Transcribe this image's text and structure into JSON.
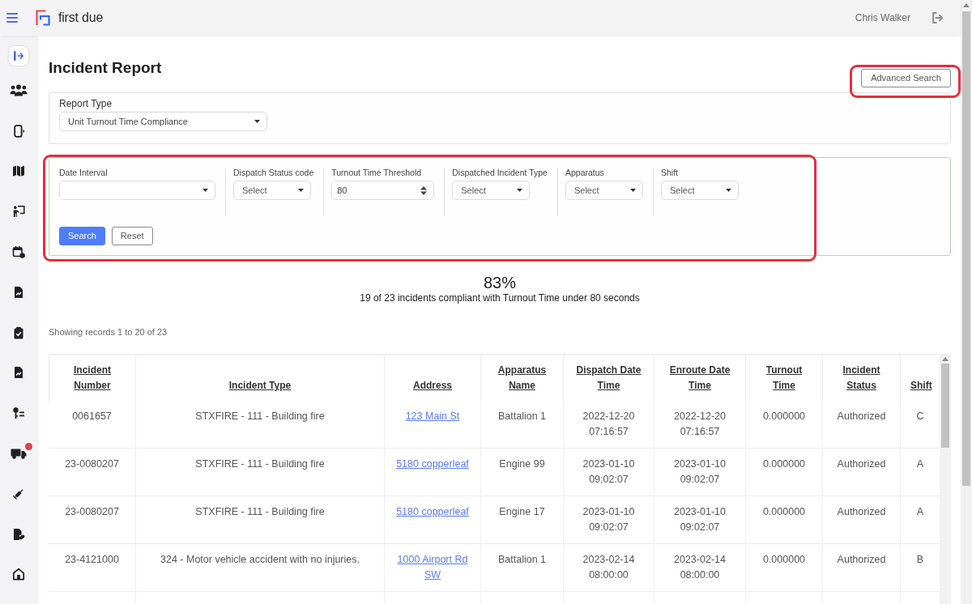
{
  "topbar": {
    "brand": "first due",
    "user": "Chris Walker"
  },
  "sidebar": {
    "items": [
      {
        "selected": true,
        "alert": false
      },
      {
        "selected": false,
        "alert": false
      },
      {
        "selected": false,
        "alert": false
      },
      {
        "selected": false,
        "alert": false
      },
      {
        "selected": false,
        "alert": false
      },
      {
        "selected": false,
        "alert": false
      },
      {
        "selected": false,
        "alert": false
      },
      {
        "selected": false,
        "alert": false
      },
      {
        "selected": false,
        "alert": false
      },
      {
        "selected": false,
        "alert": false
      },
      {
        "selected": false,
        "alert": true
      },
      {
        "selected": false,
        "alert": false
      },
      {
        "selected": false,
        "alert": false
      },
      {
        "selected": false,
        "alert": false
      }
    ]
  },
  "page": {
    "title": "Incident Report",
    "advanced_search": {
      "label": "Advanced Search",
      "highlighted": true
    }
  },
  "report_type": {
    "label": "Report Type",
    "value": "Unit Turnout Time Compliance"
  },
  "filters": {
    "highlighted": true,
    "fields": [
      {
        "label": "Date Interval",
        "kind": "select"
      },
      {
        "label": "Dispatch Status code",
        "kind": "select",
        "placeholder": "Select"
      },
      {
        "label": "Turnout Time Threshold",
        "kind": "number",
        "value": "80"
      },
      {
        "label": "Dispatched Incident Type",
        "kind": "select",
        "placeholder": "Select"
      },
      {
        "label": "Apparatus",
        "kind": "select",
        "placeholder": "Select"
      },
      {
        "label": "Shift",
        "kind": "select",
        "placeholder": "Select"
      }
    ],
    "buttons": [
      {
        "label": "Search",
        "kind": "primary"
      },
      {
        "label": "Reset",
        "kind": "secondary"
      }
    ]
  },
  "summary": {
    "percent": "83%",
    "text": "19 of 23 incidents compliant with Turnout Time under 80 seconds"
  },
  "records_info": "Showing records 1 to 20 of 23",
  "table": {
    "columns": [
      {
        "label": "Incident Number",
        "kind": "text"
      },
      {
        "label": "Incident Type",
        "kind": "text"
      },
      {
        "label": "Address",
        "kind": "link"
      },
      {
        "label": "Apparatus Name",
        "kind": "text"
      },
      {
        "label": "Dispatch Date Time",
        "kind": "text"
      },
      {
        "label": "Enroute Date Time",
        "kind": "text"
      },
      {
        "label": "Turnout Time",
        "kind": "text"
      },
      {
        "label": "Incident Status",
        "kind": "text"
      },
      {
        "label": "Shift",
        "kind": "text"
      }
    ],
    "rows": [
      [
        "0061657",
        "STXFIRE - 111 - Building fire",
        "123 Main St",
        "Battalion 1",
        "2022-12-20 07:16:57",
        "2022-12-20 07:16:57",
        "0.000000",
        "Authorized",
        "C"
      ],
      [
        "23-0080207",
        "STXFIRE - 111 - Building fire",
        "5180 copperleaf",
        "Engine 99",
        "2023-01-10 09:02:07",
        "2023-01-10 09:02:07",
        "0.000000",
        "Authorized",
        "A"
      ],
      [
        "23-0080207",
        "STXFIRE - 111 - Building fire",
        "5180 copperleaf",
        "Engine 17",
        "2023-01-10 09:02:07",
        "2023-01-10 09:02:07",
        "0.000000",
        "Authorized",
        "A"
      ],
      [
        "23-4121000",
        "324 - Motor vehicle accident with no injuries.",
        "1000 Airport Rd SW",
        "Battalion 1",
        "2023-02-14 08:00:00",
        "2023-02-14 08:00:00",
        "0.000000",
        "Authorized",
        "B"
      ]
    ]
  }
}
